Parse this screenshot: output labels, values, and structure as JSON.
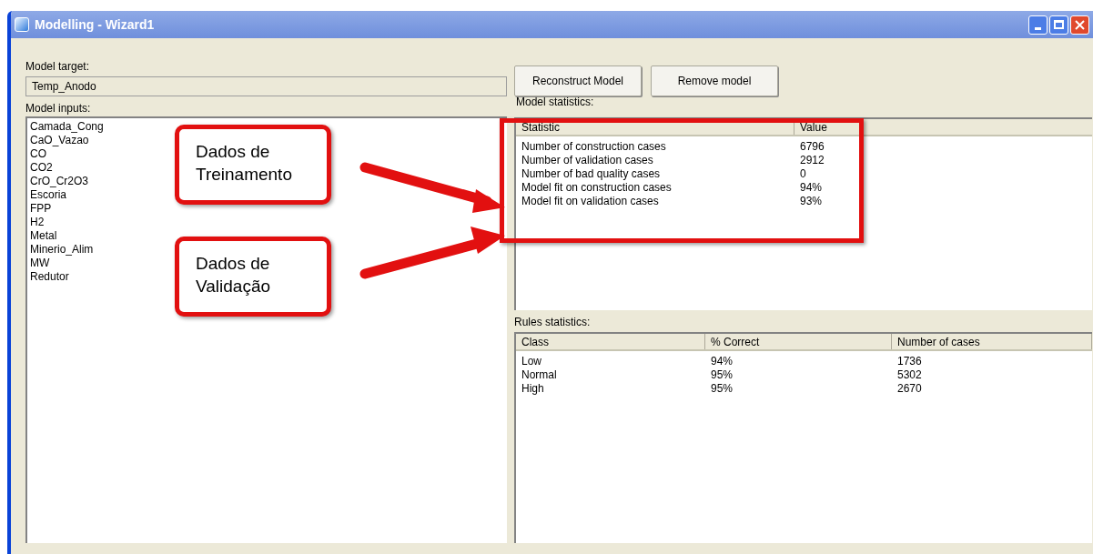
{
  "window": {
    "title": "Modelling - Wizard1"
  },
  "model_target": {
    "label": "Model target:",
    "value": "Temp_Anodo"
  },
  "buttons": [
    "Reconstruct Model",
    "Remove model"
  ],
  "model_inputs": {
    "label": "Model inputs:",
    "items": [
      "Camada_Cong",
      "CaO_Vazao",
      "CO",
      "CO2",
      "CrO_Cr2O3",
      "Escoria",
      "FPP",
      "H2",
      "Metal",
      "Minerio_Alim",
      "MW",
      "Redutor"
    ]
  },
  "model_statistics": {
    "label": "Model statistics:",
    "columns": [
      "Statistic",
      "Value"
    ],
    "rows": [
      [
        "Number of construction cases",
        "6796"
      ],
      [
        "Number of validation cases",
        "2912"
      ],
      [
        "Number of bad quality cases",
        "0"
      ],
      [
        "Model fit on construction cases",
        "94%"
      ],
      [
        "Model fit on validation cases",
        "93%"
      ]
    ]
  },
  "rules_statistics": {
    "label": "Rules statistics:",
    "columns": [
      "Class",
      "% Correct",
      "Number of cases"
    ],
    "rows": [
      [
        "Low",
        "94%",
        "1736"
      ],
      [
        "Normal",
        "95%",
        "5302"
      ],
      [
        "High",
        "95%",
        "2670"
      ]
    ]
  },
  "callouts": [
    {
      "text": "Dados de Treinamento"
    },
    {
      "text": "Dados de Validação"
    }
  ]
}
